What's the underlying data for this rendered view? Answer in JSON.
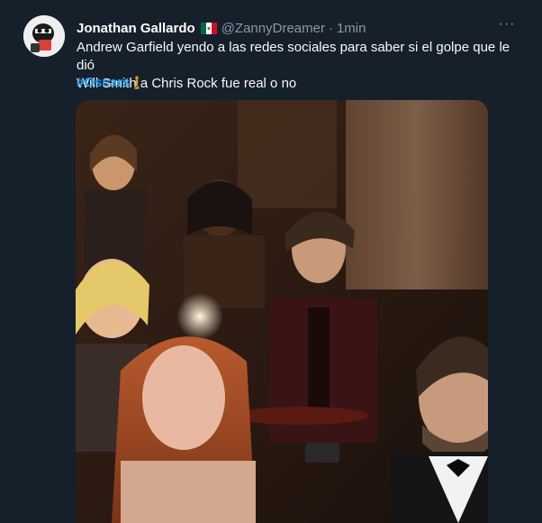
{
  "tweet": {
    "author_name": "Jonathan Gallardo",
    "flag_icon": "mexico-flag-icon",
    "handle": "@ZannyDreamer",
    "separator": "·",
    "time": "1min",
    "more_label": "···",
    "text_line1": "Andrew Garfield yendo a las redes sociales para saber si el golpe que le dió",
    "text_line2": "Will Smith a Chris Rock fue real o no",
    "hashtag": "#Oscars",
    "hashtag_icon": "oscar-statuette-icon",
    "media_icon": "embedded-photo",
    "colors": {
      "background": "#15202b",
      "secondary_text": "#8b98a5",
      "link": "#1d9bf0"
    }
  }
}
